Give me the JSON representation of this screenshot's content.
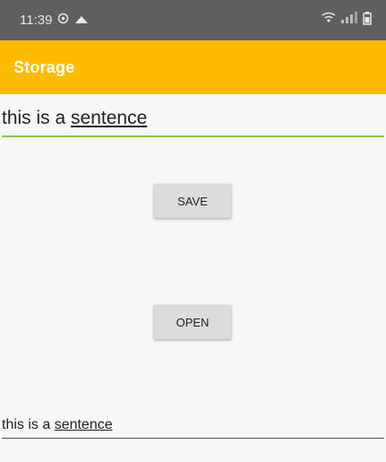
{
  "status_bar": {
    "time": "11:39",
    "left_icons": [
      "sync-icon",
      "cloud-icon"
    ],
    "right_icons": [
      "wifi-icon",
      "signal-icon",
      "battery-icon"
    ]
  },
  "app_bar": {
    "title": "Storage"
  },
  "input_top": {
    "prefix": "this is a ",
    "underlined_word": "sentence"
  },
  "buttons": {
    "save_label": "SAVE",
    "open_label": "OPEN"
  },
  "output_bottom": {
    "prefix": "this is a ",
    "underlined_word": "sentence"
  },
  "colors": {
    "status_bar": "#5f5f5f",
    "app_bar": "#ffbb00",
    "accent_underline": "#8bc34a",
    "button": "#dcdcdc"
  }
}
